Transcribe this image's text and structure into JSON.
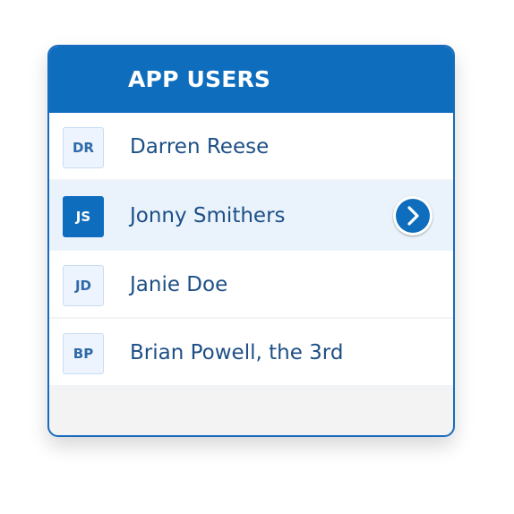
{
  "panel": {
    "title": "APP USERS"
  },
  "users": [
    {
      "initials": "DR",
      "name": "Darren Reese",
      "selected": false
    },
    {
      "initials": "JS",
      "name": "Jonny Smithers",
      "selected": true
    },
    {
      "initials": "JD",
      "name": "Janie Doe",
      "selected": false
    },
    {
      "initials": "BP",
      "name": "Brian Powell, the 3rd",
      "selected": false
    }
  ],
  "selected_row_action_icon": "chevron-right-icon",
  "colors": {
    "accent": "#0f6dbd",
    "selected_row_background": "#eaf3fc",
    "name_text": "#1d4f86",
    "panel_footer": "#f3f3f3"
  }
}
